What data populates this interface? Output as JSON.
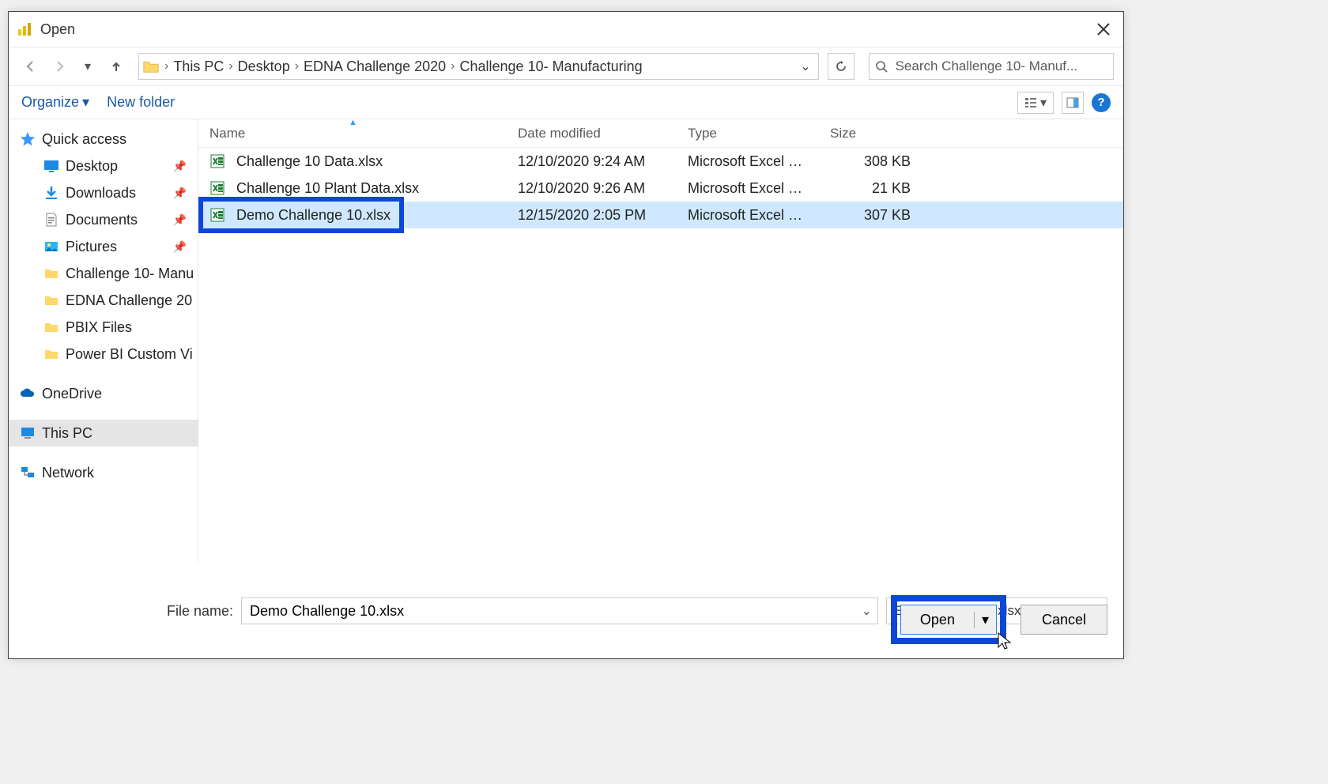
{
  "dialog": {
    "title": "Open",
    "breadcrumb": [
      "This PC",
      "Desktop",
      "EDNA Challenge 2020",
      "Challenge 10- Manufacturing"
    ],
    "search_placeholder": "Search Challenge 10- Manuf...",
    "toolbar": {
      "organize": "Organize",
      "newfolder": "New folder"
    }
  },
  "sidebar": {
    "quick_access": "Quick access",
    "items": [
      {
        "label": "Desktop",
        "pinned": true
      },
      {
        "label": "Downloads",
        "pinned": true
      },
      {
        "label": "Documents",
        "pinned": true
      },
      {
        "label": "Pictures",
        "pinned": true
      },
      {
        "label": "Challenge 10- Manu"
      },
      {
        "label": "EDNA Challenge 20"
      },
      {
        "label": "PBIX Files"
      },
      {
        "label": "Power BI Custom Vi"
      }
    ],
    "onedrive": "OneDrive",
    "thispc": "This PC",
    "network": "Network"
  },
  "columns": {
    "name": "Name",
    "date": "Date modified",
    "type": "Type",
    "size": "Size"
  },
  "files": [
    {
      "name": "Challenge 10 Data.xlsx",
      "date": "12/10/2020 9:24 AM",
      "type": "Microsoft Excel W...",
      "size": "308 KB",
      "selected": false
    },
    {
      "name": "Challenge 10 Plant Data.xlsx",
      "date": "12/10/2020 9:26 AM",
      "type": "Microsoft Excel W...",
      "size": "21 KB",
      "selected": false
    },
    {
      "name": "Demo Challenge 10.xlsx",
      "date": "12/15/2020 2:05 PM",
      "type": "Microsoft Excel W...",
      "size": "307 KB",
      "selected": true,
      "highlighted": true
    }
  ],
  "footer": {
    "filename_label": "File name:",
    "filename_value": "Demo Challenge 10.xlsx",
    "filter": "Excel Files (*.xl;*.xlsx;*.xlsm;*.xl",
    "open": "Open",
    "cancel": "Cancel"
  }
}
